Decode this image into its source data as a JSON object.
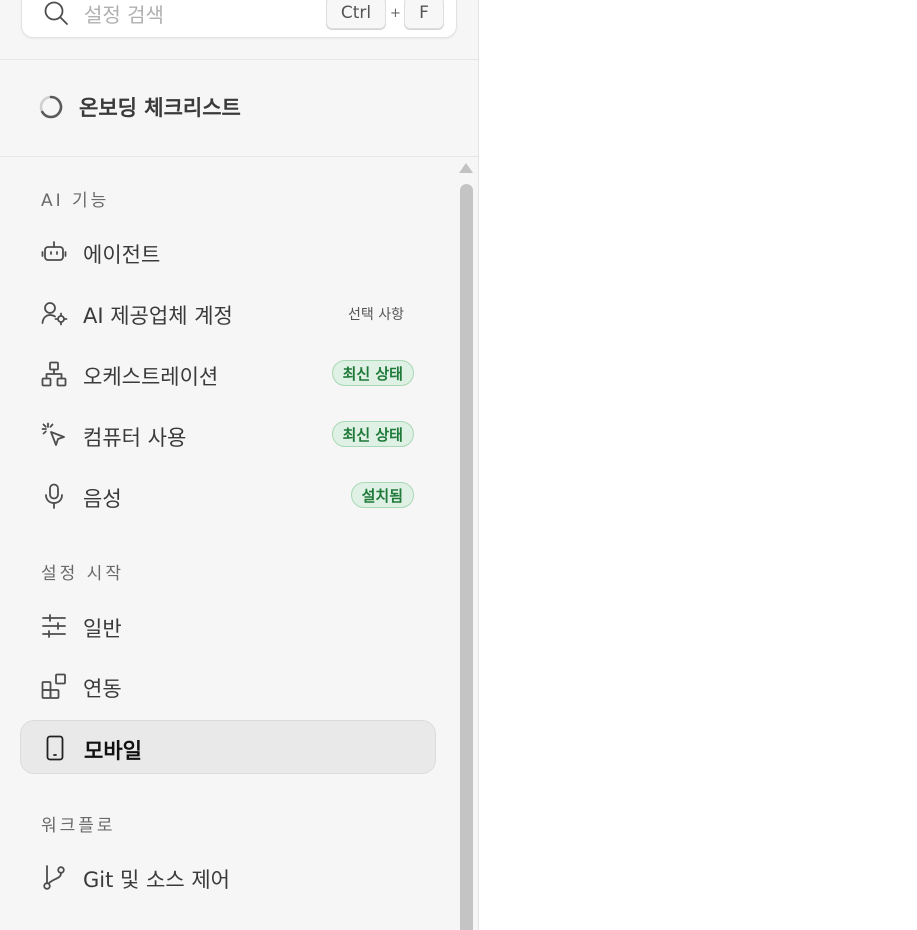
{
  "search": {
    "placeholder": "설정 검색",
    "shortcut_ctrl": "Ctrl",
    "shortcut_plus": "+",
    "shortcut_key": "F"
  },
  "onboarding": {
    "label": "온보딩 체크리스트"
  },
  "sections": {
    "ai": {
      "title": "AI 기능",
      "items": [
        {
          "label": "에이전트",
          "icon": "robot-icon"
        },
        {
          "label": "AI 제공업체 계정",
          "icon": "user-gear-icon",
          "tag": "선택 사항"
        },
        {
          "label": "오케스트레이션",
          "icon": "hierarchy-icon",
          "badge": "최신 상태"
        },
        {
          "label": "컴퓨터 사용",
          "icon": "cursor-click-icon",
          "badge": "최신 상태"
        },
        {
          "label": "음성",
          "icon": "microphone-icon",
          "badge": "설치됨"
        }
      ]
    },
    "setup": {
      "title": "설정 시작",
      "items": [
        {
          "label": "일반",
          "icon": "sliders-icon"
        },
        {
          "label": "연동",
          "icon": "integrations-icon"
        },
        {
          "label": "모바일",
          "icon": "mobile-icon",
          "active": true
        }
      ]
    },
    "workflow": {
      "title": "워크플로",
      "items": [
        {
          "label": "Git 및 소스 제어",
          "icon": "git-branch-icon"
        }
      ]
    }
  },
  "colors": {
    "sidebar_bg": "#f6f6f6",
    "badge_bg": "#dff1e4",
    "badge_text": "#1f7a3a",
    "active_bg": "#e9e9e9"
  }
}
